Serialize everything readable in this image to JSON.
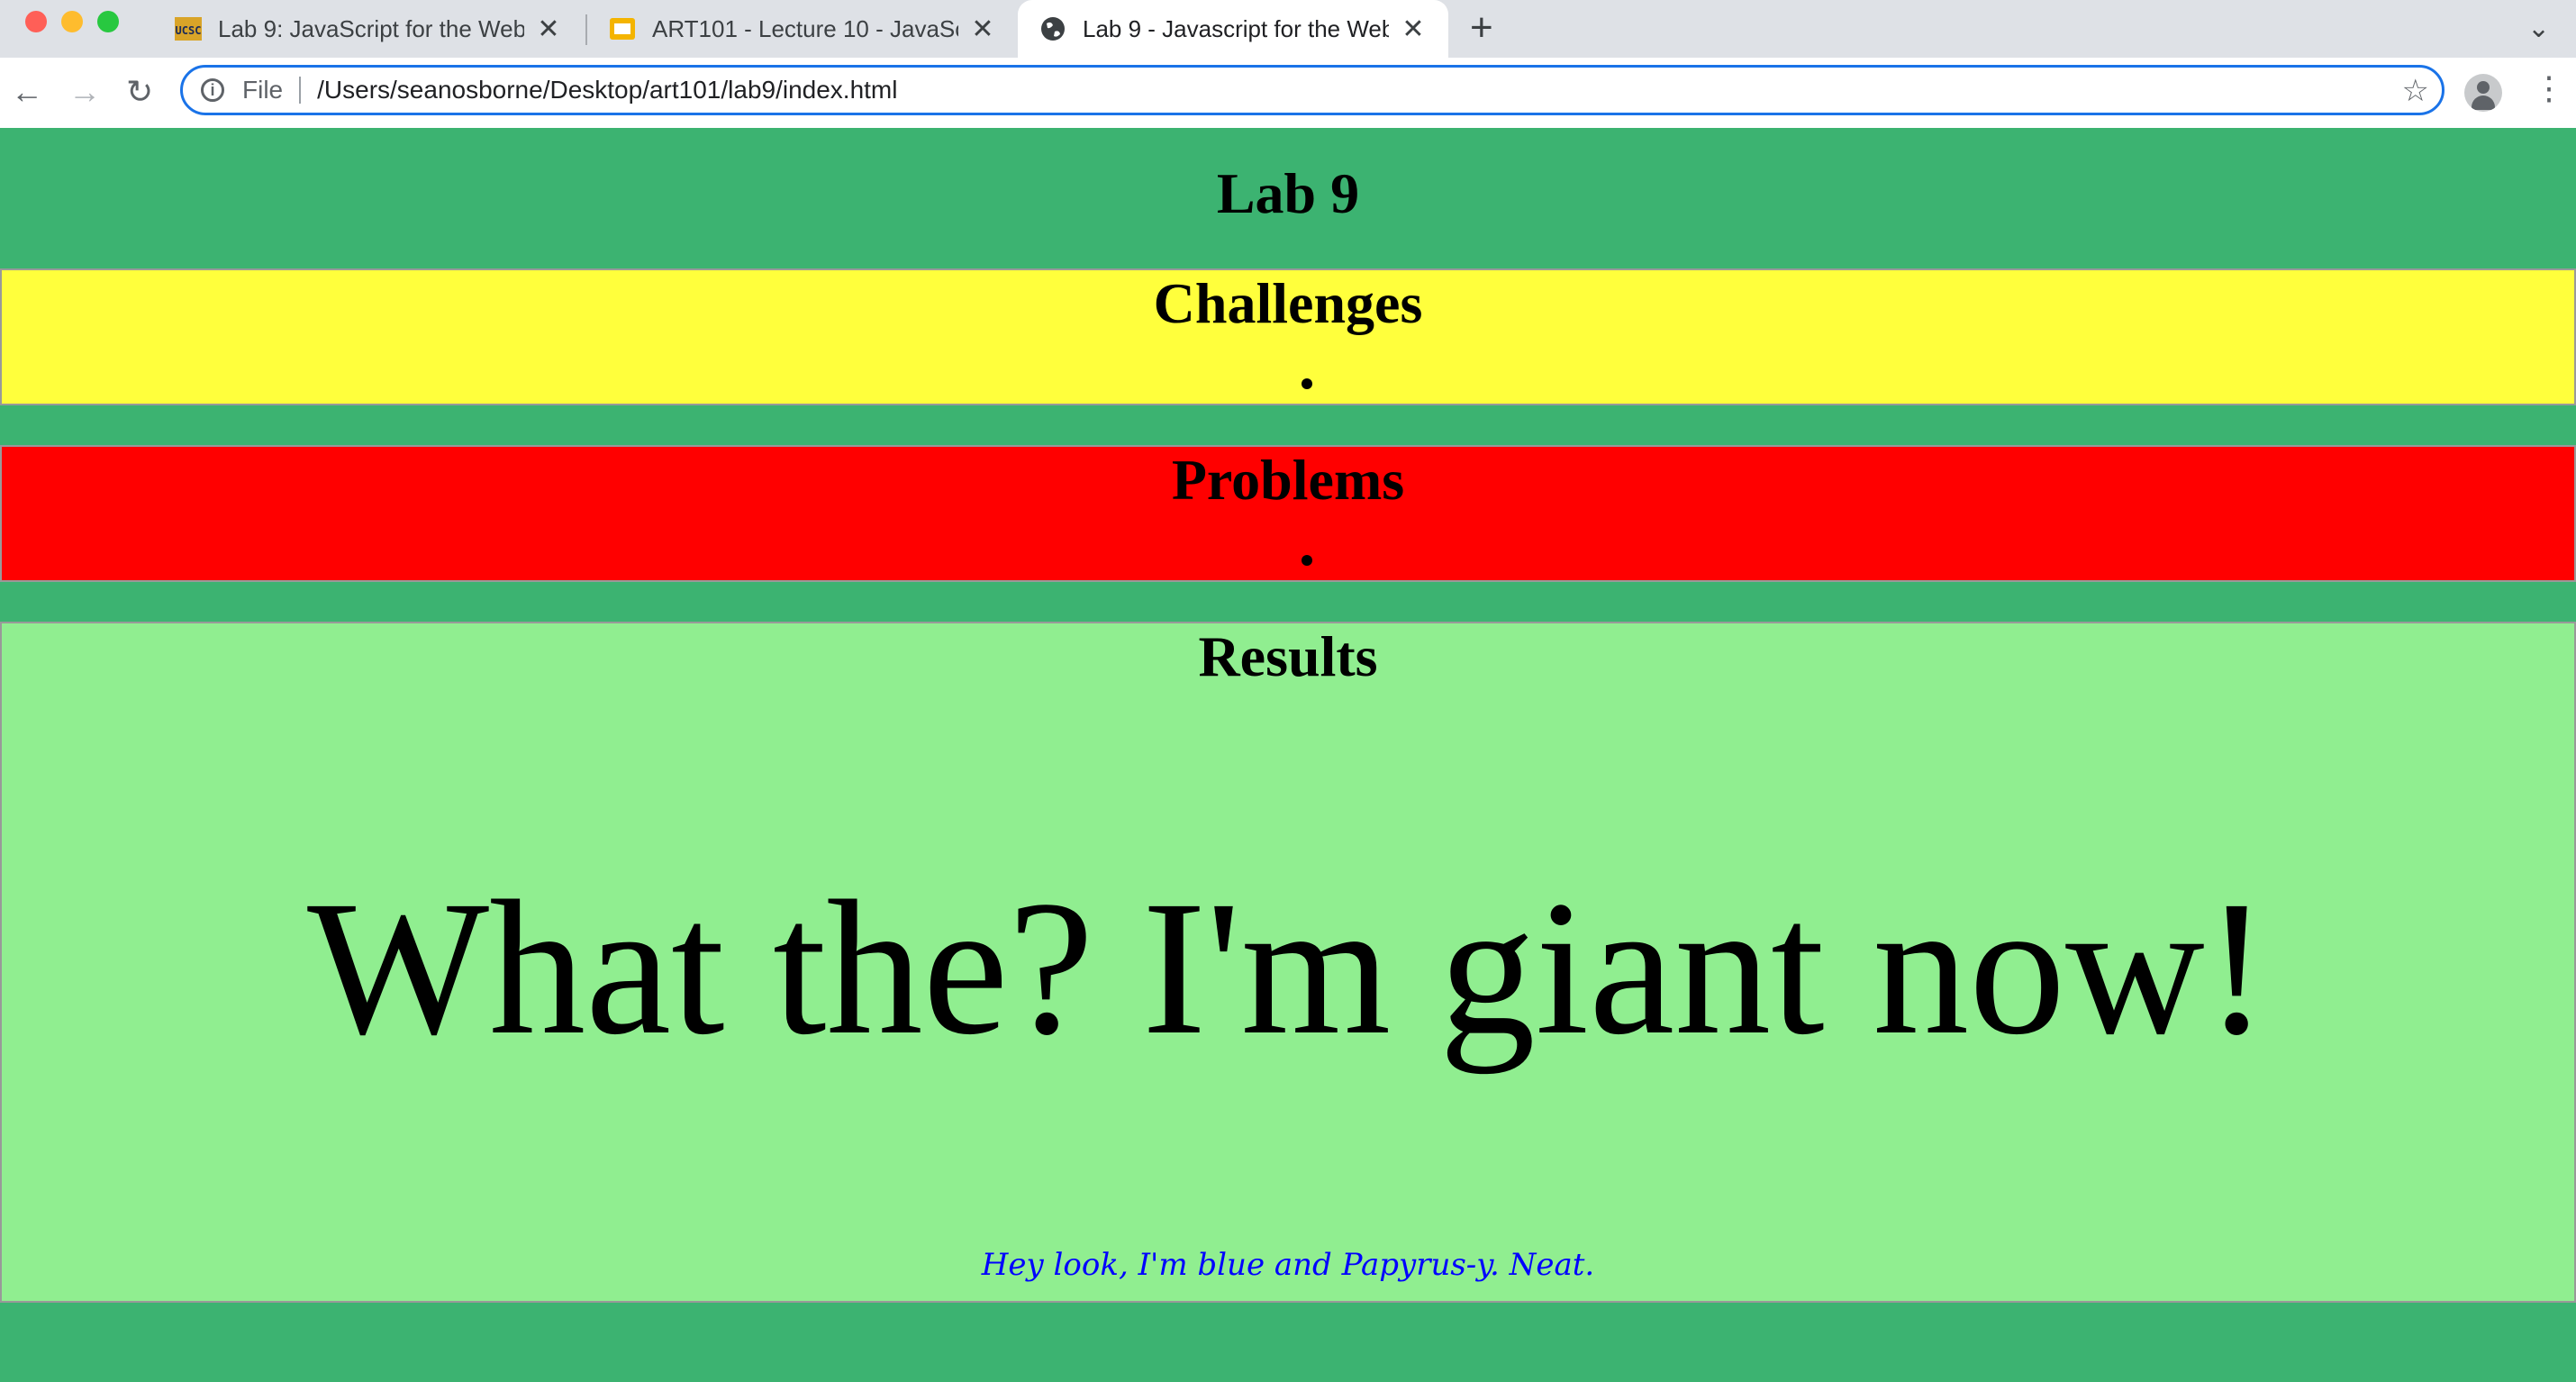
{
  "browser": {
    "tabs": [
      {
        "label": "Lab 9: JavaScript for the Web",
        "favicon": "ucsc-logo-icon",
        "active": false
      },
      {
        "label": "ART101 - Lecture 10 - JavaScri",
        "favicon": "slides-icon",
        "active": false
      },
      {
        "label": "Lab 9 - Javascript for the Web",
        "favicon": "globe-icon",
        "active": true
      }
    ],
    "address": {
      "scheme": "File",
      "url": "/Users/seanosborne/Desktop/art101/lab9/index.html"
    },
    "colors": {
      "omnibox_focus": "#1a73e8",
      "tabstrip": "#dee1e6"
    }
  },
  "page": {
    "title": "Lab 9",
    "sections": {
      "challenges": "Challenges",
      "problems": "Problems",
      "results": "Results"
    },
    "giant_text": "What the? I'm giant now!",
    "blue_text": "Hey look, I'm blue and Papyrus-y. Neat.",
    "colors": {
      "background": "#3cb371",
      "challenges": "#ffff3c",
      "problems": "#ff0000",
      "results": "#90ee90",
      "blue_text": "#0000ff"
    }
  }
}
